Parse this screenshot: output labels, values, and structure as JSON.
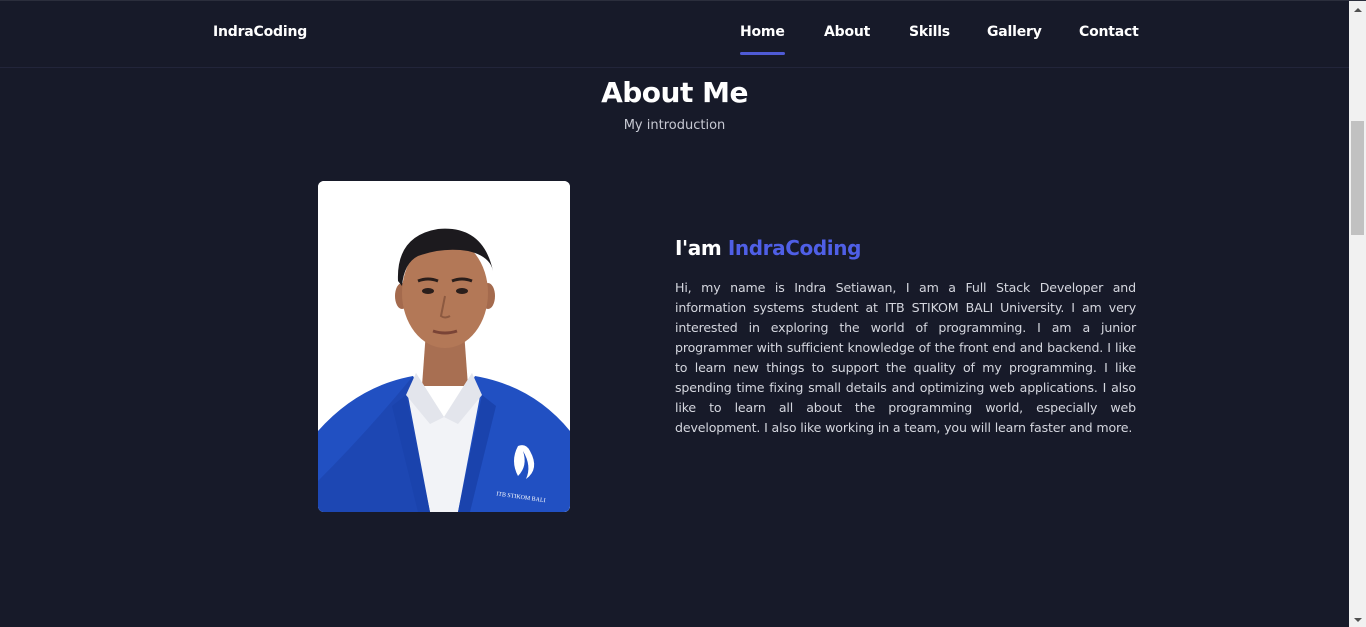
{
  "header": {
    "logo": "IndraCoding",
    "nav": [
      {
        "label": "Home",
        "active": true
      },
      {
        "label": "About",
        "active": false
      },
      {
        "label": "Skills",
        "active": false
      },
      {
        "label": "Gallery",
        "active": false
      },
      {
        "label": "Contact",
        "active": false
      }
    ]
  },
  "about": {
    "title": "About Me",
    "subtitle": "My introduction",
    "greeting_prefix": "I'am",
    "greeting_name": "IndraCoding",
    "description": "Hi, my name is Indra Setiawan, I am a Full Stack Developer and information systems student at ITB STIKOM BALI University. I am very interested in exploring the world of programming. I am a junior programmer with sufficient knowledge of the front end and backend. I like to learn new things to support the quality of my programming. I like spending time fixing small details and optimizing web applications. I also like to learn all about the programming world, especially web development. I also like working in a team, you will learn faster and more.",
    "photo_badge_text": "ITB STIKOM BALI"
  },
  "colors": {
    "background": "#171a29",
    "accent": "#4f5fe6",
    "nav_underline": "#4f5bd5",
    "text": "#ffffff",
    "muted_text": "#d4d6de"
  }
}
